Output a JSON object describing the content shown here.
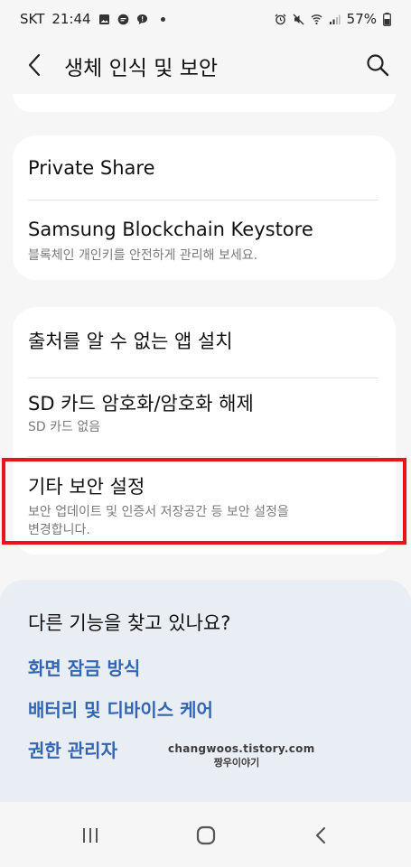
{
  "status": {
    "carrier": "SKT",
    "time": "21:44",
    "battery": "57%"
  },
  "appbar": {
    "title": "생체 인식 및 보안"
  },
  "card1": [
    {
      "title": "Private Share"
    },
    {
      "title": "Samsung Blockchain Keystore",
      "subtitle": "블록체인 개인키를 안전하게 관리해 보세요."
    }
  ],
  "card2": [
    {
      "title": "출처를 알 수 없는 앱 설치"
    },
    {
      "title": "SD 카드 암호화/암호화 해제",
      "subtitle": "SD 카드 없음"
    },
    {
      "title": "기타 보안 설정",
      "subtitle_line1": "보안 업데이트 및 인증서 저장공간 등 보안 설정을",
      "subtitle_line2": "변경합니다."
    }
  ],
  "suggestions": {
    "question": "다른 기능을 찾고 있나요?",
    "links": [
      "화면 잠금 방식",
      "배터리 및 디바이스 케어",
      "권한 관리자"
    ]
  },
  "watermark": {
    "line1": "changwoos.tistory.com",
    "line2": "짱우이야기"
  },
  "colors": {
    "highlight": "#e8141b",
    "link": "#3266b3"
  }
}
